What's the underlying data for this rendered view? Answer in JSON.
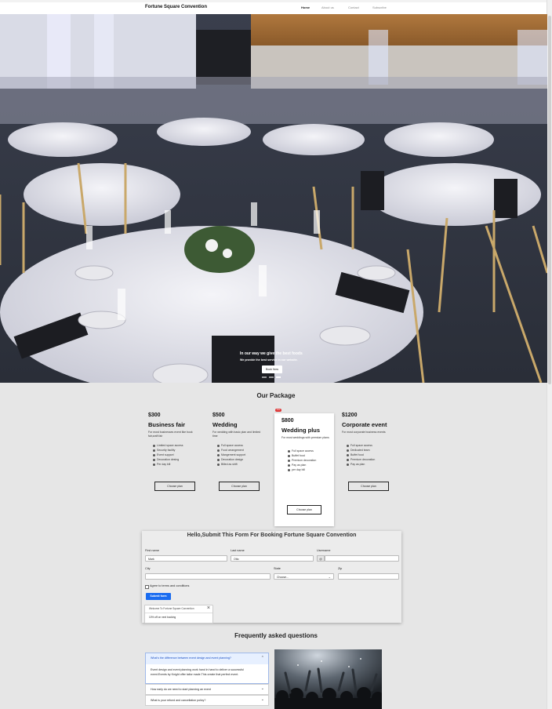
{
  "nav": {
    "brand": "Fortune Square Convention",
    "links": [
      {
        "label": "Home",
        "active": true
      },
      {
        "label": "About us",
        "active": false
      },
      {
        "label": "Contact",
        "active": false
      },
      {
        "label": "Subscribe",
        "active": false
      }
    ]
  },
  "hero": {
    "caption_title": "In our way we give the best foods",
    "caption_text": "We provide the best service in our website.",
    "button_label": "Book Now",
    "slides": 3,
    "active_slide": 3
  },
  "packages": {
    "title": "Our Package",
    "plans": [
      {
        "price": "$300",
        "name": "Business fair",
        "description": "For most businesses event like book fair,craft fair",
        "features": [
          "Limited space access",
          "Security facility",
          "Event support",
          "Decoration desing",
          "Per day bill"
        ],
        "button": "Choose plan"
      },
      {
        "price": "$500",
        "name": "Wedding",
        "description": "For wedding with basic plan and limited time",
        "features": [
          "Full space access",
          "Food arrangement",
          "Mangement support",
          "Decoration design",
          "Billed as shift"
        ],
        "button": "Choose plan"
      },
      {
        "price": "$800",
        "name": "Wedding plus",
        "description": "For most weddings with premium plans",
        "features": [
          "Full space access",
          "Buffet food",
          "Premium decoration",
          "Pay as plan",
          "per day bill"
        ],
        "button": "Choose plan",
        "badge": "new"
      },
      {
        "price": "$1200",
        "name": "Corporate event",
        "description": "For most corporate business events",
        "features": [
          "Full space access",
          "Dedicated team",
          "Buffet food",
          "Premium decoration",
          "Pay as plan"
        ],
        "button": "Choose plan"
      }
    ]
  },
  "form": {
    "title": "Hello,Submit This Form For Booking Fortune Square Convention",
    "first_name": {
      "label": "First name",
      "value": "Mark"
    },
    "last_name": {
      "label": "Last name",
      "value": "Otto"
    },
    "username": {
      "label": "Username",
      "value": "",
      "prefix": "@"
    },
    "city": {
      "label": "City",
      "value": ""
    },
    "state": {
      "label": "State",
      "value": "Choose..."
    },
    "zip": {
      "label": "Zip",
      "value": ""
    },
    "agree": "Agree to terms and conditions",
    "submit": "Submit form",
    "toast": {
      "title": "Welcome To Fortune Square Convention",
      "body": "10% off on next booking"
    }
  },
  "faq": {
    "title": "Frequently asked questions",
    "items": [
      {
        "question": "What's the difference between event design and event planning?",
        "answer": "Event design and event planning work hand in hand to deliver a successful event.Events by Knight offer tailor made.This create that perfect event.",
        "open": true
      },
      {
        "question": "How early do we need to start planning an event",
        "open": false
      },
      {
        "question": "What is your refund and cancellation policy?",
        "open": false
      }
    ]
  },
  "colors": {
    "primary": "#1a6cf0",
    "background": "#e6e6e6",
    "faq_active": "#1a4fc4"
  }
}
